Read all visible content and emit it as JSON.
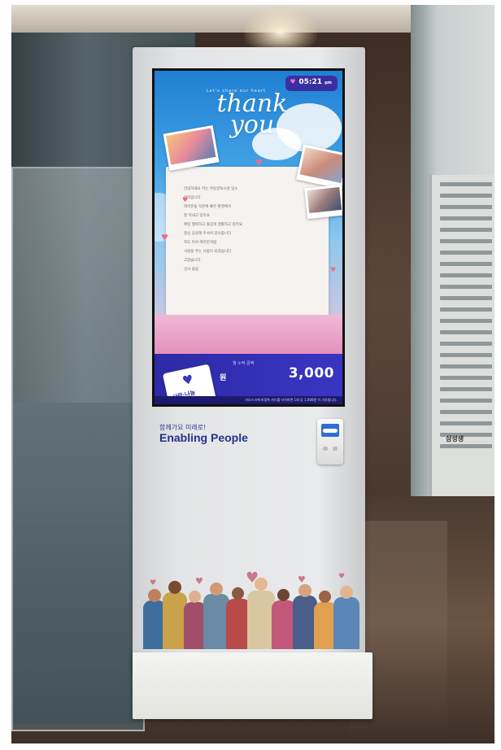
{
  "screen": {
    "clock": "05:21",
    "clock_suffix": "pm",
    "small_caption": "Let's share our heart",
    "title_line1": "thank",
    "title_line2": "you",
    "letter_lines": [
      "안녕하세요 저는 아동양육시설 입소",
      "아이입니다",
      "여러분들 덕분에 좋은 환경에서",
      "잘 지내고 있어요",
      "매일 행복하고 즐겁게 생활하고 있어요",
      "항상 응원해 주셔서 감사합니다",
      "저도 커서 여러분처럼",
      "사랑을 주는 사람이 되겠습니다",
      "고맙습니다",
      "감사 올림"
    ],
    "donation_label": "월 누적 금액",
    "donation_unit": "원",
    "donation_amount": "3,000",
    "tag_text": "사랑·나눔",
    "ticker": "키오스크에 비접촉 카드를 터치하면 1회 당 1,000원 이 기부됩니다."
  },
  "kiosk": {
    "slogan_kr": "함께가요 미래로!",
    "slogan_en": "Enabling People"
  },
  "directory": {
    "label": "삼성생"
  },
  "colors": {
    "brand_blue": "#1f3488",
    "screen_accent": "#2d2aa8",
    "heart_pink": "#ef6c8a"
  }
}
